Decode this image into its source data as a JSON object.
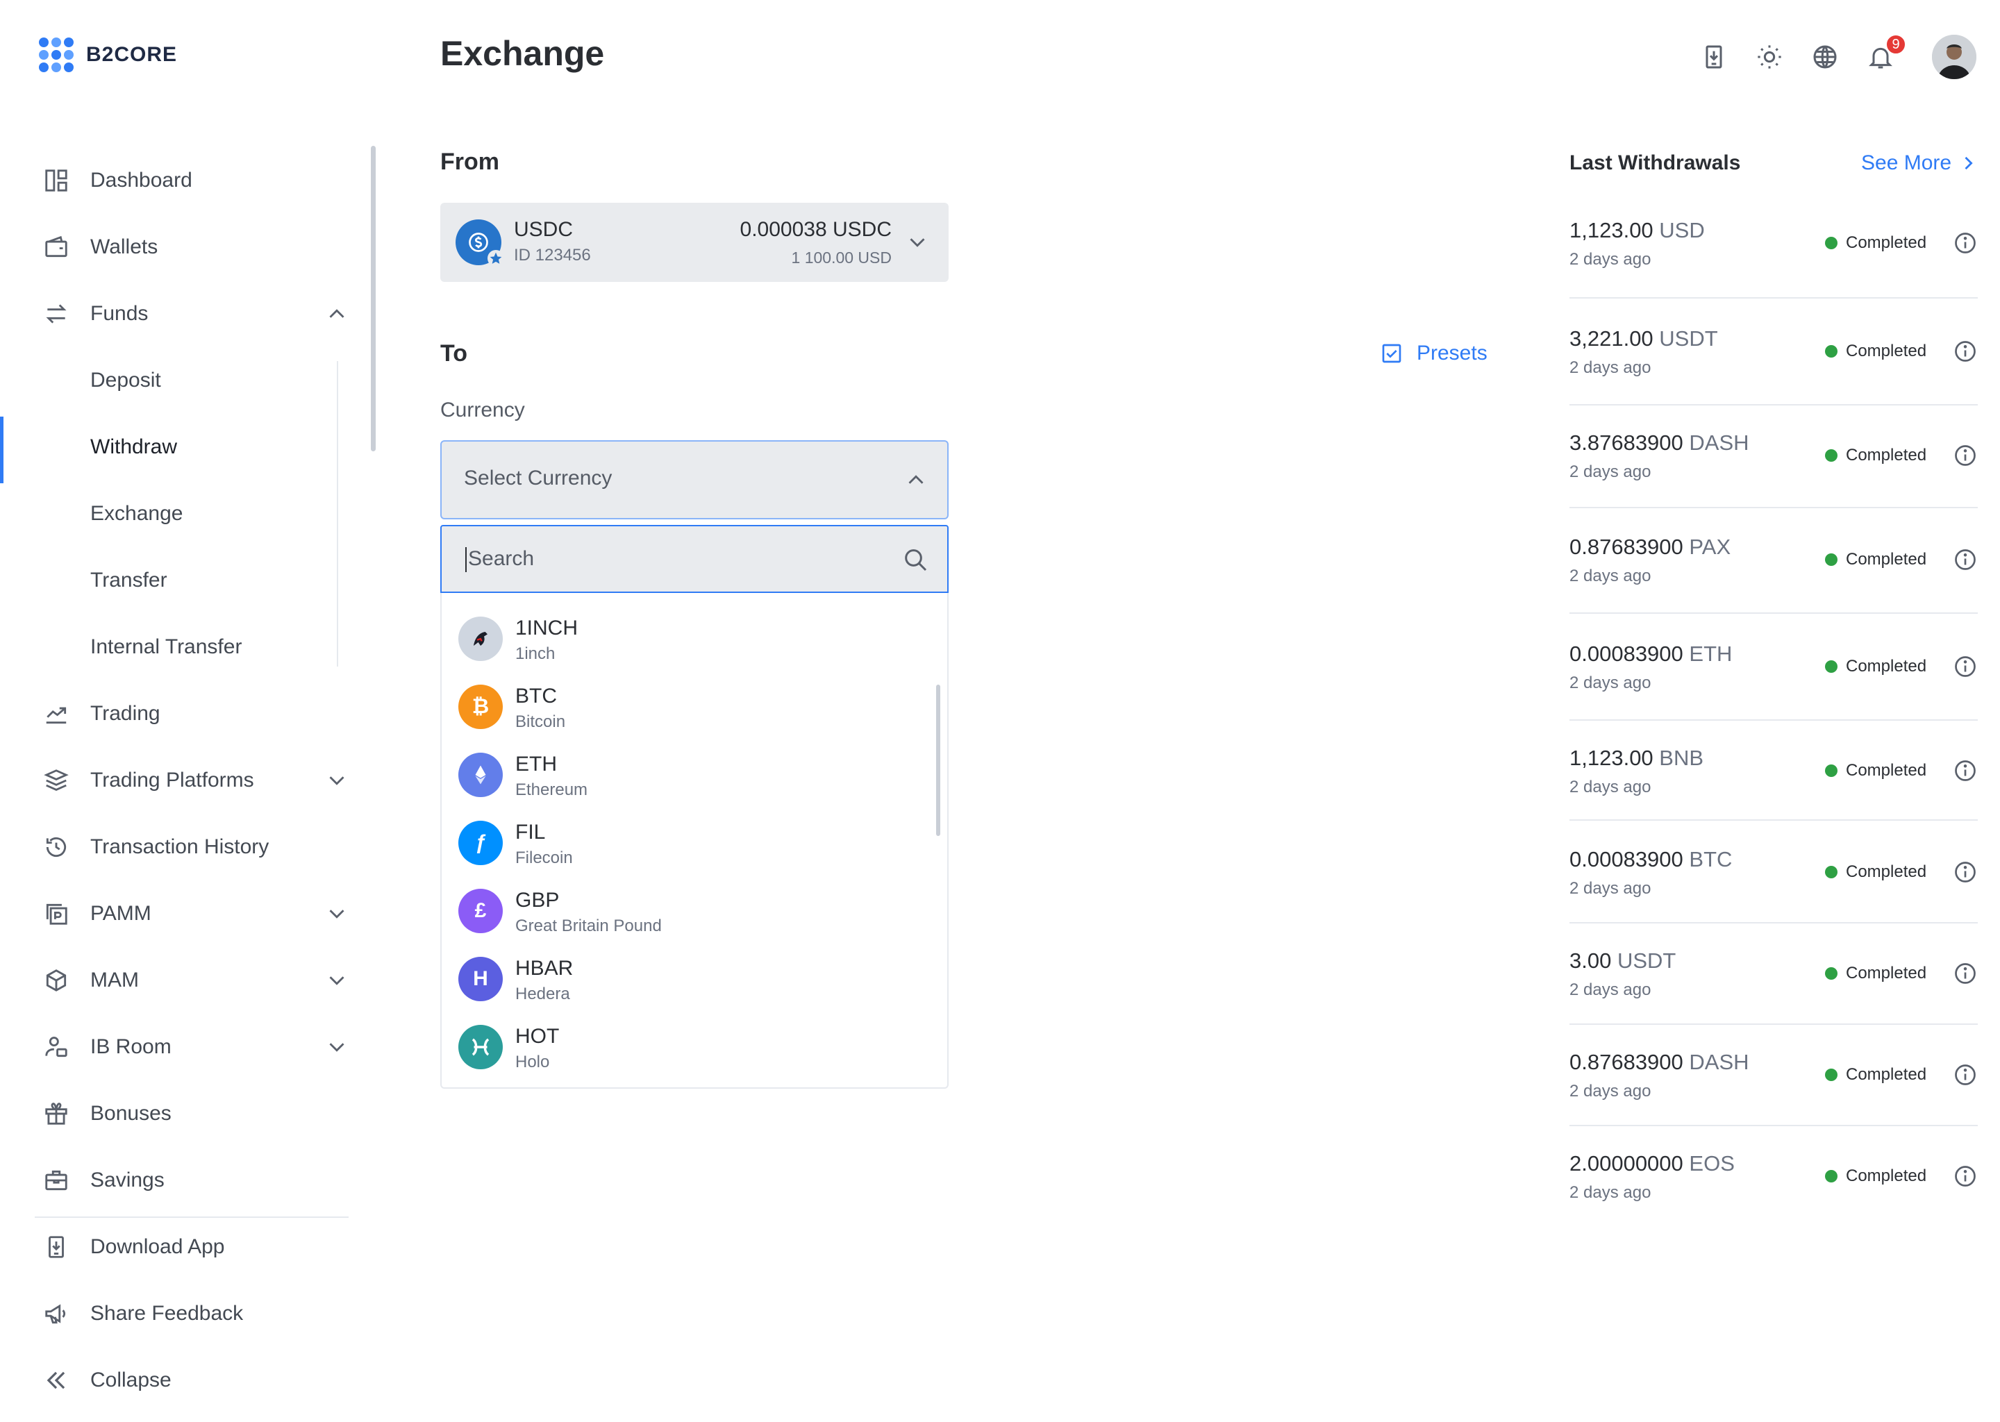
{
  "app": {
    "brand": "B2CORE"
  },
  "header": {
    "title": "Exchange",
    "notifications_count": "9"
  },
  "sidebar": {
    "items": [
      {
        "label": "Dashboard",
        "icon": "dashboard-icon"
      },
      {
        "label": "Wallets",
        "icon": "wallet-icon"
      },
      {
        "label": "Funds",
        "icon": "transfer-arrows-icon",
        "expanded": true
      },
      {
        "label": "Deposit"
      },
      {
        "label": "Withdraw",
        "active": true
      },
      {
        "label": "Exchange"
      },
      {
        "label": "Transfer"
      },
      {
        "label": "Internal Transfer"
      },
      {
        "label": "Trading",
        "icon": "trend-chart-icon"
      },
      {
        "label": "Trading Platforms",
        "icon": "layers-icon"
      },
      {
        "label": "Transaction History",
        "icon": "history-icon"
      },
      {
        "label": "PAMM",
        "icon": "pamm-icon"
      },
      {
        "label": "MAM",
        "icon": "cube-icon"
      },
      {
        "label": "IB Room",
        "icon": "users-icon"
      },
      {
        "label": "Bonuses",
        "icon": "gift-icon"
      },
      {
        "label": "Savings",
        "icon": "briefcase-icon"
      },
      {
        "label": "Download App",
        "icon": "download-app-icon"
      },
      {
        "label": "Share Feedback",
        "icon": "megaphone-icon"
      },
      {
        "label": "Collapse",
        "icon": "double-chevron-left-icon"
      }
    ]
  },
  "from": {
    "label": "From",
    "currency": "USDC",
    "account_id": "ID 123456",
    "amount": "0.000038 USDC",
    "amount_usd": "1 100.00 USD"
  },
  "to": {
    "label": "To",
    "presets_label": "Presets",
    "currency_label": "Currency",
    "select_placeholder": "Select Currency",
    "search_placeholder": "Search"
  },
  "currencies": [
    {
      "code": "1INCH",
      "name": "1inch",
      "color": "#cfd6e0"
    },
    {
      "code": "BTC",
      "name": "Bitcoin",
      "color": "#f7931a"
    },
    {
      "code": "ETH",
      "name": "Ethereum",
      "color": "#627eea"
    },
    {
      "code": "FIL",
      "name": "Filecoin",
      "color": "#0090ff"
    },
    {
      "code": "GBP",
      "name": "Great Britain Pound",
      "color": "#8b5cf6"
    },
    {
      "code": "HBAR",
      "name": "Hedera",
      "color": "#5b5fe0"
    },
    {
      "code": "HOT",
      "name": "Holo",
      "color": "#2a9d9a"
    }
  ],
  "withdrawals": {
    "title": "Last Withdrawals",
    "see_more": "See More",
    "items": [
      {
        "amount": "1,123.00",
        "currency": "USD",
        "ago": "2 days ago",
        "status": "Completed"
      },
      {
        "amount": "3,221.00",
        "currency": "USDT",
        "ago": "2 days ago",
        "status": "Completed"
      },
      {
        "amount": "3.87683900",
        "currency": "DASH",
        "ago": "2 days ago",
        "status": "Completed"
      },
      {
        "amount": "0.87683900",
        "currency": "PAX",
        "ago": "2 days ago",
        "status": "Completed"
      },
      {
        "amount": "0.00083900",
        "currency": "ETH",
        "ago": "2 days ago",
        "status": "Completed"
      },
      {
        "amount": "1,123.00",
        "currency": "BNB",
        "ago": "2 days ago",
        "status": "Completed"
      },
      {
        "amount": "0.00083900",
        "currency": "BTC",
        "ago": "2 days ago",
        "status": "Completed"
      },
      {
        "amount": "3.00",
        "currency": "USDT",
        "ago": "2 days ago",
        "status": "Completed"
      },
      {
        "amount": "0.87683900",
        "currency": "DASH",
        "ago": "2 days ago",
        "status": "Completed"
      },
      {
        "amount": "2.00000000",
        "currency": "EOS",
        "ago": "2 days ago",
        "status": "Completed"
      }
    ]
  },
  "colors": {
    "accent": "#2f7bf5",
    "status_completed": "#2ea043",
    "badge": "#e53935"
  }
}
